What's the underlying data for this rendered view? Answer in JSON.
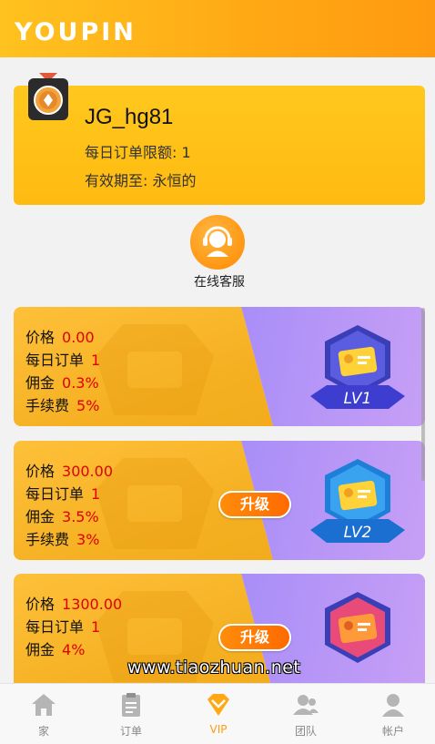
{
  "app": {
    "logo": "YOUPIN"
  },
  "profile": {
    "username": "JG_hg81",
    "daily_limit": "每日订单限额: 1",
    "validity": "有效期至: 永恒的"
  },
  "service": {
    "label": "在线客服"
  },
  "vip_levels": [
    {
      "price_label": "价格",
      "price": "0.00",
      "orders_label": "每日订单",
      "orders": "1",
      "commission_label": "佣金",
      "commission": "0.3%",
      "fee_label": "手续费",
      "fee": "5%",
      "level": "LV1",
      "upgrade": ""
    },
    {
      "price_label": "价格",
      "price": "300.00",
      "orders_label": "每日订单",
      "orders": "1",
      "commission_label": "佣金",
      "commission": "3.5%",
      "fee_label": "手续费",
      "fee": "3%",
      "level": "LV2",
      "upgrade": "升级"
    },
    {
      "price_label": "价格",
      "price": "1300.00",
      "orders_label": "每日订单",
      "orders": "1",
      "commission_label": "佣金",
      "commission": "4%",
      "fee_label": "手续费",
      "fee": "",
      "level": "",
      "upgrade": "升级"
    }
  ],
  "tabs": [
    {
      "label": "家",
      "icon": "home-icon"
    },
    {
      "label": "订单",
      "icon": "clipboard-icon"
    },
    {
      "label": "VIP",
      "icon": "diamond-icon"
    },
    {
      "label": "团队",
      "icon": "group-icon"
    },
    {
      "label": "帐户",
      "icon": "user-icon"
    }
  ],
  "watermark": "www.tiaozhuan.net",
  "colors": {
    "brand": "#ffb414",
    "price_value": "#e00000",
    "active_tab": "#ff9d10"
  }
}
